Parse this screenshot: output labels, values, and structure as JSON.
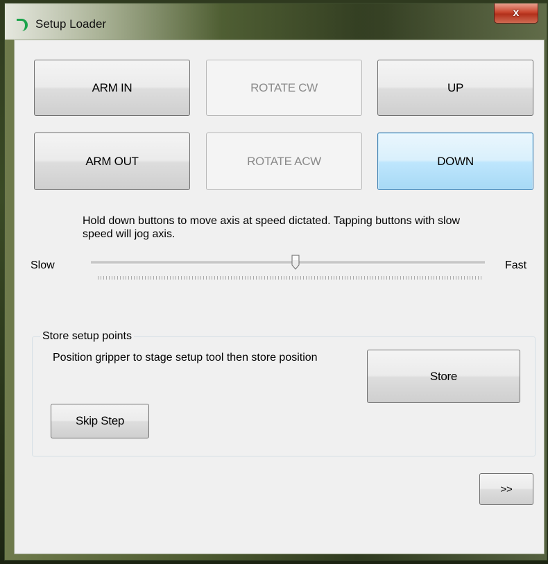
{
  "window": {
    "title": "Setup Loader",
    "close_glyph": "x"
  },
  "controls": {
    "arm_in": "ARM IN",
    "rotate_cw": "ROTATE CW",
    "up": "UP",
    "arm_out": "ARM OUT",
    "rotate_acw": "ROTATE ACW",
    "down": "DOWN"
  },
  "hint": "Hold down buttons to move axis at speed dictated. Tapping buttons with slow speed will jog axis.",
  "speed": {
    "min_label": "Slow",
    "max_label": "Fast",
    "value_fraction": 0.52
  },
  "store_group": {
    "title": "Store setup points",
    "description": "Position gripper to stage setup tool then store position",
    "store_label": "Store",
    "skip_label": "Skip Step"
  },
  "next_label": ">>",
  "icons": {
    "app": "setup-loader-icon",
    "close": "close-icon",
    "thumb": "slider-thumb-icon"
  },
  "colors": {
    "focus_border": "#3c7fb1",
    "close_red": "#c8452d",
    "app_icon_green": "#1aa34a"
  }
}
